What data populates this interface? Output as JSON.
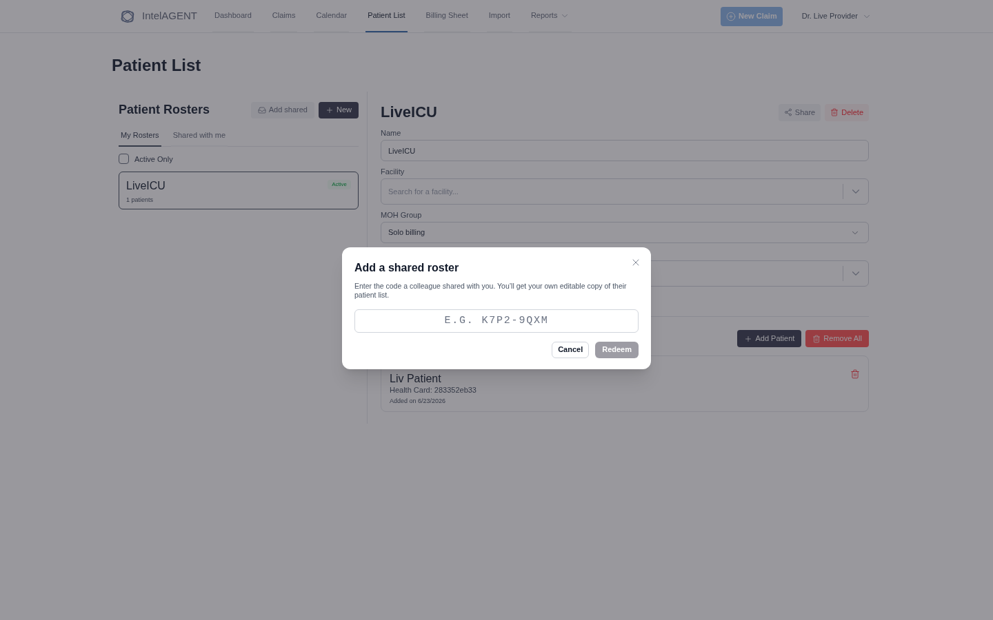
{
  "nav": {
    "brand": "IntelAGENT",
    "items": [
      {
        "label": "Dashboard",
        "kind": "link",
        "selected": false
      },
      {
        "label": "Claims",
        "kind": "link",
        "selected": false
      },
      {
        "label": "Calendar",
        "kind": "link",
        "selected": false
      },
      {
        "label": "Patient List",
        "kind": "link",
        "selected": true
      },
      {
        "label": "Billing Sheet",
        "kind": "link",
        "selected": false
      },
      {
        "label": "Import",
        "kind": "link",
        "selected": false
      },
      {
        "label": "Reports",
        "kind": "dropdown",
        "selected": false
      }
    ],
    "new_claim": "New Claim",
    "user": "Dr. Live Provider"
  },
  "page_title": "Patient List",
  "rosters_panel": {
    "title": "Patient Rosters",
    "add_shared": "Add shared",
    "new": "New",
    "tabs": [
      {
        "label": "My Rosters",
        "selected": true
      },
      {
        "label": "Shared with me",
        "selected": false
      }
    ],
    "active_only": {
      "label": "Active Only",
      "checked": false
    },
    "rosters": [
      {
        "name": "LiveICU",
        "badge": "Active",
        "count": "1 patients",
        "selected": true
      }
    ]
  },
  "detail": {
    "title": "LiveICU",
    "share": "Share",
    "delete": "Delete",
    "fields": [
      {
        "kind": "text",
        "label": "Name",
        "value": "LiveICU"
      },
      {
        "kind": "search_select",
        "label": "Facility",
        "placeholder": "Search for a facility..."
      },
      {
        "kind": "select",
        "label": "MOH Group",
        "value": "Solo billing"
      },
      {
        "kind": "search_select"
      }
    ],
    "add_patient": "Add Patient",
    "remove_all": "Remove All",
    "patients": [
      {
        "name": "Liv Patient",
        "health_card": "Health Card: 283352eb33",
        "added": "Added on 6/23/2026"
      }
    ]
  },
  "dialog": {
    "title": "Add a shared roster",
    "description": "Enter the code a colleague shared with you. You’ll get your own editable copy of their patient list.",
    "code_field": {
      "placeholder": "E.G. K7P2-9QXM"
    },
    "cancel": "Cancel",
    "redeem": {
      "label": "Redeem",
      "disabled": true
    }
  }
}
